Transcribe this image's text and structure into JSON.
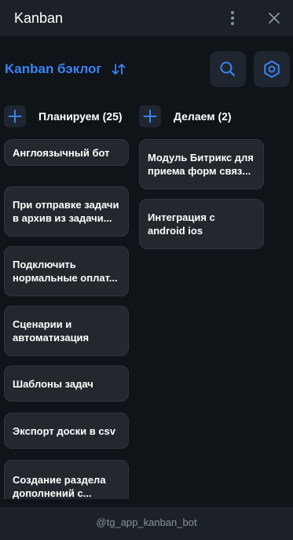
{
  "window": {
    "title": "Kanban"
  },
  "header": {
    "board_title": "Kanban бэклог"
  },
  "columns": [
    {
      "title": "Планируем (25)",
      "cards": [
        "Англоязычный бот",
        "При отправке задачи в архив из задачи...",
        "Подключить нормальные оплат...",
        "Сценарии и автоматизация",
        "Шаблоны задач",
        "Экспорт доски в csv",
        "Создание раздела дополнений с..."
      ]
    },
    {
      "title": "Делаем (2)",
      "cards": [
        "Модуль Битрикс для приема форм связ...",
        "Интеграция с android ios"
      ]
    }
  ],
  "footer": {
    "text": "@tg_app_kanban_bot"
  },
  "colors": {
    "accent": "#3b82f6",
    "background": "#0f1419",
    "card": "#23272e",
    "bar": "#1c2128"
  },
  "icons": [
    "more-vertical-icon",
    "close-icon",
    "sort-icon",
    "search-icon",
    "settings-icon",
    "plus-icon"
  ]
}
